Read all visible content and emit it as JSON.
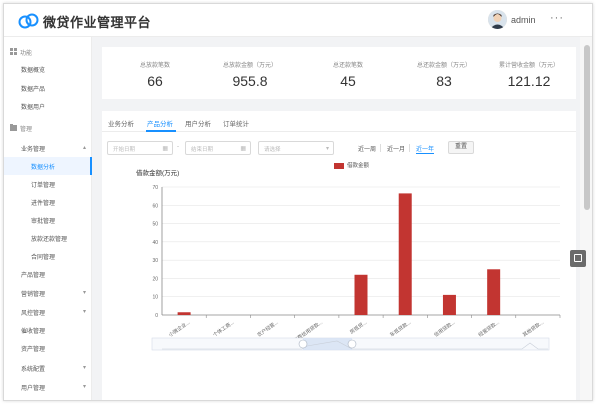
{
  "header": {
    "app_title": "微贷作业管理平台",
    "user_name": "admin",
    "more_label": "···"
  },
  "sidebar": {
    "items": [
      {
        "label": "功能",
        "kind": "group",
        "icon": "grid-icon"
      },
      {
        "label": "数据概览",
        "kind": "item"
      },
      {
        "label": "数据产品",
        "kind": "item"
      },
      {
        "label": "数据用户",
        "kind": "item"
      },
      {
        "label": "管理",
        "kind": "group",
        "icon": "folder-icon"
      },
      {
        "label": "业务管理",
        "kind": "parent",
        "caret": "▴"
      },
      {
        "label": "数据分析",
        "kind": "child",
        "active": true
      },
      {
        "label": "订单管理",
        "kind": "child"
      },
      {
        "label": "进件管理",
        "kind": "child"
      },
      {
        "label": "审批管理",
        "kind": "child"
      },
      {
        "label": "放款还款管理",
        "kind": "child"
      },
      {
        "label": "合同管理",
        "kind": "child"
      },
      {
        "label": "产品管理",
        "kind": "parent"
      },
      {
        "label": "营销管理",
        "kind": "parent",
        "caret": "▾"
      },
      {
        "label": "风控管理",
        "kind": "parent",
        "caret": "▾"
      },
      {
        "label": "催收管理",
        "kind": "parent"
      },
      {
        "label": "资产管理",
        "kind": "parent"
      },
      {
        "label": "系统配置",
        "kind": "parent",
        "caret": "▾"
      },
      {
        "label": "用户管理",
        "kind": "parent",
        "caret": "▾"
      }
    ]
  },
  "stats": [
    {
      "label": "总放款笔数",
      "value": "66"
    },
    {
      "label": "总放款金额（万元）",
      "value": "955.8"
    },
    {
      "label": "总还款笔数",
      "value": "45"
    },
    {
      "label": "总还款金额（万元）",
      "value": "83"
    },
    {
      "label": "累计营收金额（万元）",
      "value": "121.12"
    }
  ],
  "tabs": [
    {
      "label": "业务分析",
      "active": false
    },
    {
      "label": "产品分析",
      "active": true
    },
    {
      "label": "用户分析",
      "active": false
    },
    {
      "label": "订单统计",
      "active": false
    }
  ],
  "filters": {
    "start_placeholder": "开始日期",
    "end_placeholder": "结束日期",
    "product_placeholder": "请选择",
    "range_sep": "-",
    "quick": [
      {
        "label": "近一周",
        "active": false
      },
      {
        "label": "近一月",
        "active": false
      },
      {
        "label": "近一年",
        "active": true
      }
    ],
    "reset_label": "重置"
  },
  "chart_data": {
    "type": "bar",
    "title": "借款金额(万元)",
    "ylim": [
      0,
      70
    ],
    "yticks": [
      0,
      10,
      20,
      30,
      40,
      50,
      60,
      70
    ],
    "grid": true,
    "legend_position": "top-center",
    "categories": [
      "小微企业...",
      "个体工商...",
      "农户经营...",
      "消费信用贷款...",
      "房抵贷...",
      "车抵贷款...",
      "信用贷款...",
      "经营贷款...",
      "其他贷款..."
    ],
    "series": [
      {
        "name": "借款金额",
        "color": "#c23531",
        "values": [
          1.5,
          0,
          0,
          0,
          22,
          66.5,
          11,
          25,
          0
        ]
      }
    ]
  }
}
